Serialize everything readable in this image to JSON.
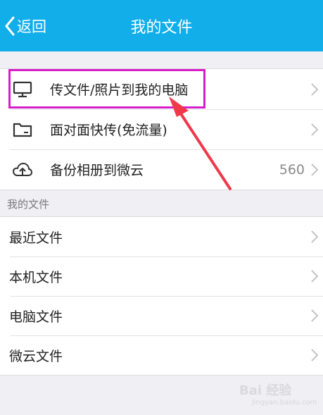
{
  "nav": {
    "back_label": "返回",
    "title": "我的文件"
  },
  "actions": [
    {
      "label": "传文件/照片到我的电脑",
      "icon": "monitor-icon"
    },
    {
      "label": "面对面快传(免流量)",
      "icon": "folder-transfer-icon"
    },
    {
      "label": "备份相册到微云",
      "icon": "cloud-upload-icon",
      "count": "560"
    }
  ],
  "section": {
    "header": "我的文件"
  },
  "files": [
    {
      "label": "最近文件"
    },
    {
      "label": "本机文件"
    },
    {
      "label": "电脑文件"
    },
    {
      "label": "微云文件"
    }
  ],
  "annotation": {
    "highlight_color": "#d51ec9",
    "arrow_color": "#f0384a"
  },
  "watermark": {
    "text": "Bai 经验",
    "sub": "jingyan.baidu.com"
  },
  "colors": {
    "navbar": "#12aeea",
    "background": "#efeff4"
  }
}
